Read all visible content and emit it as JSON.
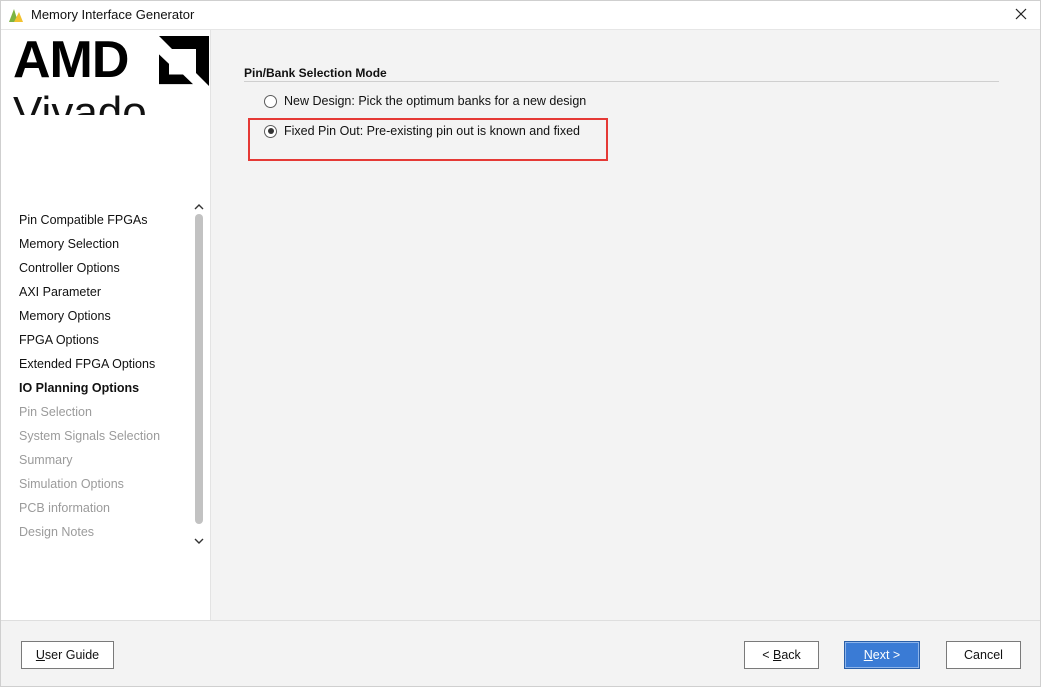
{
  "window": {
    "title": "Memory Interface Generator"
  },
  "logo": {
    "brand": "AMD",
    "product": "Vivado"
  },
  "sidebar": {
    "steps": [
      {
        "label": "Pin Compatible FPGAs",
        "state": "done"
      },
      {
        "label": "Memory Selection",
        "state": "done"
      },
      {
        "label": "Controller Options",
        "state": "done"
      },
      {
        "label": "AXI Parameter",
        "state": "done"
      },
      {
        "label": "Memory Options",
        "state": "done"
      },
      {
        "label": "FPGA Options",
        "state": "done"
      },
      {
        "label": "Extended FPGA Options",
        "state": "done"
      },
      {
        "label": "IO Planning Options",
        "state": "current"
      },
      {
        "label": "Pin Selection",
        "state": "disabled"
      },
      {
        "label": "System Signals Selection",
        "state": "disabled"
      },
      {
        "label": "Summary",
        "state": "disabled"
      },
      {
        "label": "Simulation Options",
        "state": "disabled"
      },
      {
        "label": "PCB information",
        "state": "disabled"
      },
      {
        "label": "Design Notes",
        "state": "disabled"
      }
    ]
  },
  "main": {
    "section_title": "Pin/Bank Selection Mode",
    "options": [
      {
        "label": "New Design: Pick the optimum banks for a new design",
        "selected": false
      },
      {
        "label": "Fixed Pin Out: Pre-existing pin out is known and fixed",
        "selected": true
      }
    ],
    "highlight_color": "#e53935"
  },
  "footer": {
    "user_guide": {
      "mnemonic": "U",
      "rest": "ser Guide"
    },
    "back": {
      "prefix": "< ",
      "mnemonic": "B",
      "rest": "ack"
    },
    "next": {
      "mnemonic": "N",
      "rest": "ext >"
    },
    "cancel": "Cancel"
  },
  "colors": {
    "accent": "#3a7bd5",
    "logo_green": "#7cb342",
    "logo_yellow": "#f2c230"
  }
}
